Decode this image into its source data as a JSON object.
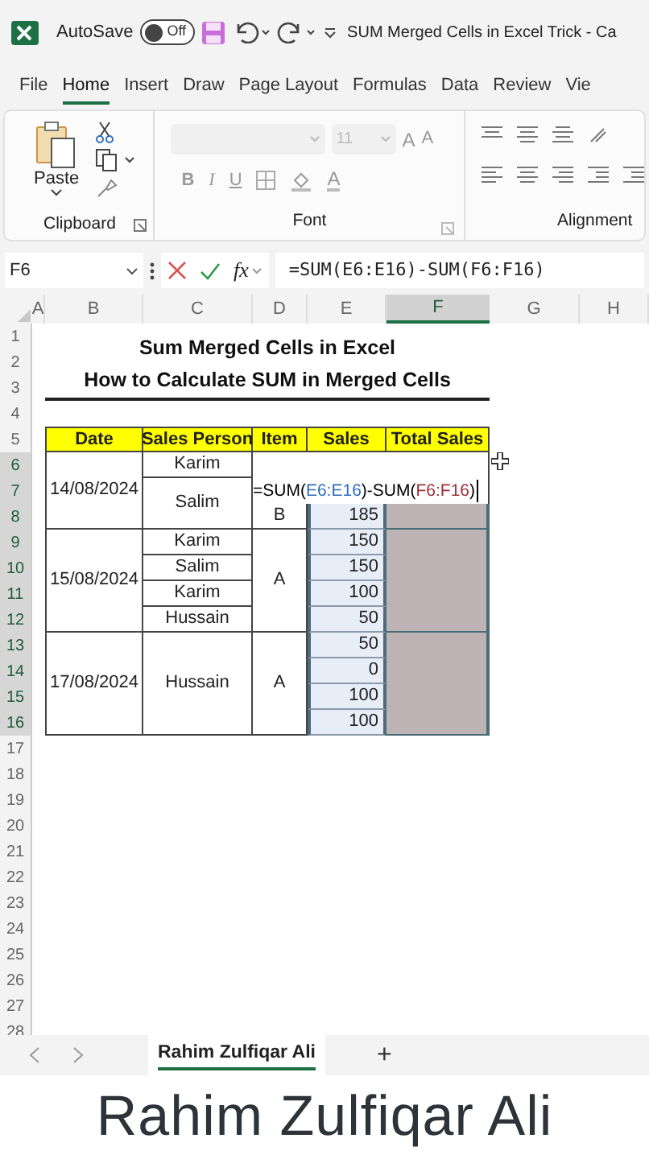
{
  "title_bar": {
    "autosave_label": "AutoSave",
    "autosave": {
      "on": false,
      "label": "Off"
    },
    "title": "SUM Merged Cells in Excel Trick - Ca"
  },
  "menu_tabs": [
    {
      "label": "File",
      "selected": false
    },
    {
      "label": "Home",
      "selected": true
    },
    {
      "label": "Insert",
      "selected": false
    },
    {
      "label": "Draw",
      "selected": false
    },
    {
      "label": "Page Layout",
      "selected": false
    },
    {
      "label": "Formulas",
      "selected": false
    },
    {
      "label": "Data",
      "selected": false
    },
    {
      "label": "Review",
      "selected": false
    },
    {
      "label": "Vie",
      "selected": false
    }
  ],
  "ribbon": {
    "paste_label": "Paste",
    "font_size": "11",
    "grow_font": "A",
    "shrink_font": "A",
    "bold": "B",
    "italic": "I",
    "underline": "U",
    "font_color": "A",
    "groups": [
      "Clipboard",
      "Font",
      "Alignment"
    ]
  },
  "formula_bar": {
    "name_box": "F6",
    "fx": "fx",
    "formula": "=SUM(E6:E16)-SUM(F6:F16)"
  },
  "column_headers": [
    {
      "label": "A",
      "selected": false
    },
    {
      "label": "B",
      "selected": false
    },
    {
      "label": "C",
      "selected": false
    },
    {
      "label": "D",
      "selected": false
    },
    {
      "label": "E",
      "selected": false
    },
    {
      "label": "F",
      "selected": true
    },
    {
      "label": "G",
      "selected": false
    },
    {
      "label": "H",
      "selected": false
    }
  ],
  "row_numbers": [
    {
      "label": "1",
      "selected": false
    },
    {
      "label": "2",
      "selected": false
    },
    {
      "label": "3",
      "selected": false
    },
    {
      "label": "4",
      "selected": false
    },
    {
      "label": "5",
      "selected": false
    },
    {
      "label": "6",
      "selected": true
    },
    {
      "label": "7",
      "selected": true
    },
    {
      "label": "8",
      "selected": true
    },
    {
      "label": "9",
      "selected": true
    },
    {
      "label": "10",
      "selected": true
    },
    {
      "label": "11",
      "selected": true
    },
    {
      "label": "12",
      "selected": true
    },
    {
      "label": "13",
      "selected": true
    },
    {
      "label": "14",
      "selected": true
    },
    {
      "label": "15",
      "selected": true
    },
    {
      "label": "16",
      "selected": true
    },
    {
      "label": "17",
      "selected": false
    },
    {
      "label": "18",
      "selected": false
    },
    {
      "label": "19",
      "selected": false
    },
    {
      "label": "20",
      "selected": false
    },
    {
      "label": "21",
      "selected": false
    },
    {
      "label": "22",
      "selected": false
    },
    {
      "label": "23",
      "selected": false
    },
    {
      "label": "24",
      "selected": false
    },
    {
      "label": "25",
      "selected": false
    },
    {
      "label": "26",
      "selected": false
    },
    {
      "label": "27",
      "selected": false
    },
    {
      "label": "28",
      "selected": false
    }
  ],
  "sheet": {
    "title_lines": [
      "Sum Merged Cells in Excel",
      "How to Calculate SUM in Merged Cells"
    ],
    "headers": [
      "Date",
      "Sales Person",
      "Item",
      "Sales",
      "Total Sales"
    ],
    "dates": [
      "14/08/2024",
      "15/08/2024",
      "17/08/2024"
    ],
    "persons": [
      "Karim",
      "Salim",
      "Karim",
      "Salim",
      "Karim",
      "Hussain",
      "Hussain"
    ],
    "items": [
      "B",
      "A",
      "A"
    ],
    "sales": [
      "185",
      "150",
      "150",
      "100",
      "50",
      "50",
      "0",
      "100",
      "100"
    ],
    "editing_formula": [
      {
        "text": "=SUM(",
        "color": "#000000"
      },
      {
        "text": "E6:E16",
        "color": "#2f6eba"
      },
      {
        "text": ")-SUM(",
        "color": "#000000"
      },
      {
        "text": "F6:F16",
        "color": "#a0303a"
      },
      {
        "text": ")",
        "color": "#000000"
      }
    ]
  },
  "sheet_tabs": [
    {
      "label": "Rahim Zulfiqar Ali",
      "selected": true
    }
  ],
  "add_sheet": "+",
  "footer": {
    "text": "Rahim Zulfiqar Ali"
  }
}
